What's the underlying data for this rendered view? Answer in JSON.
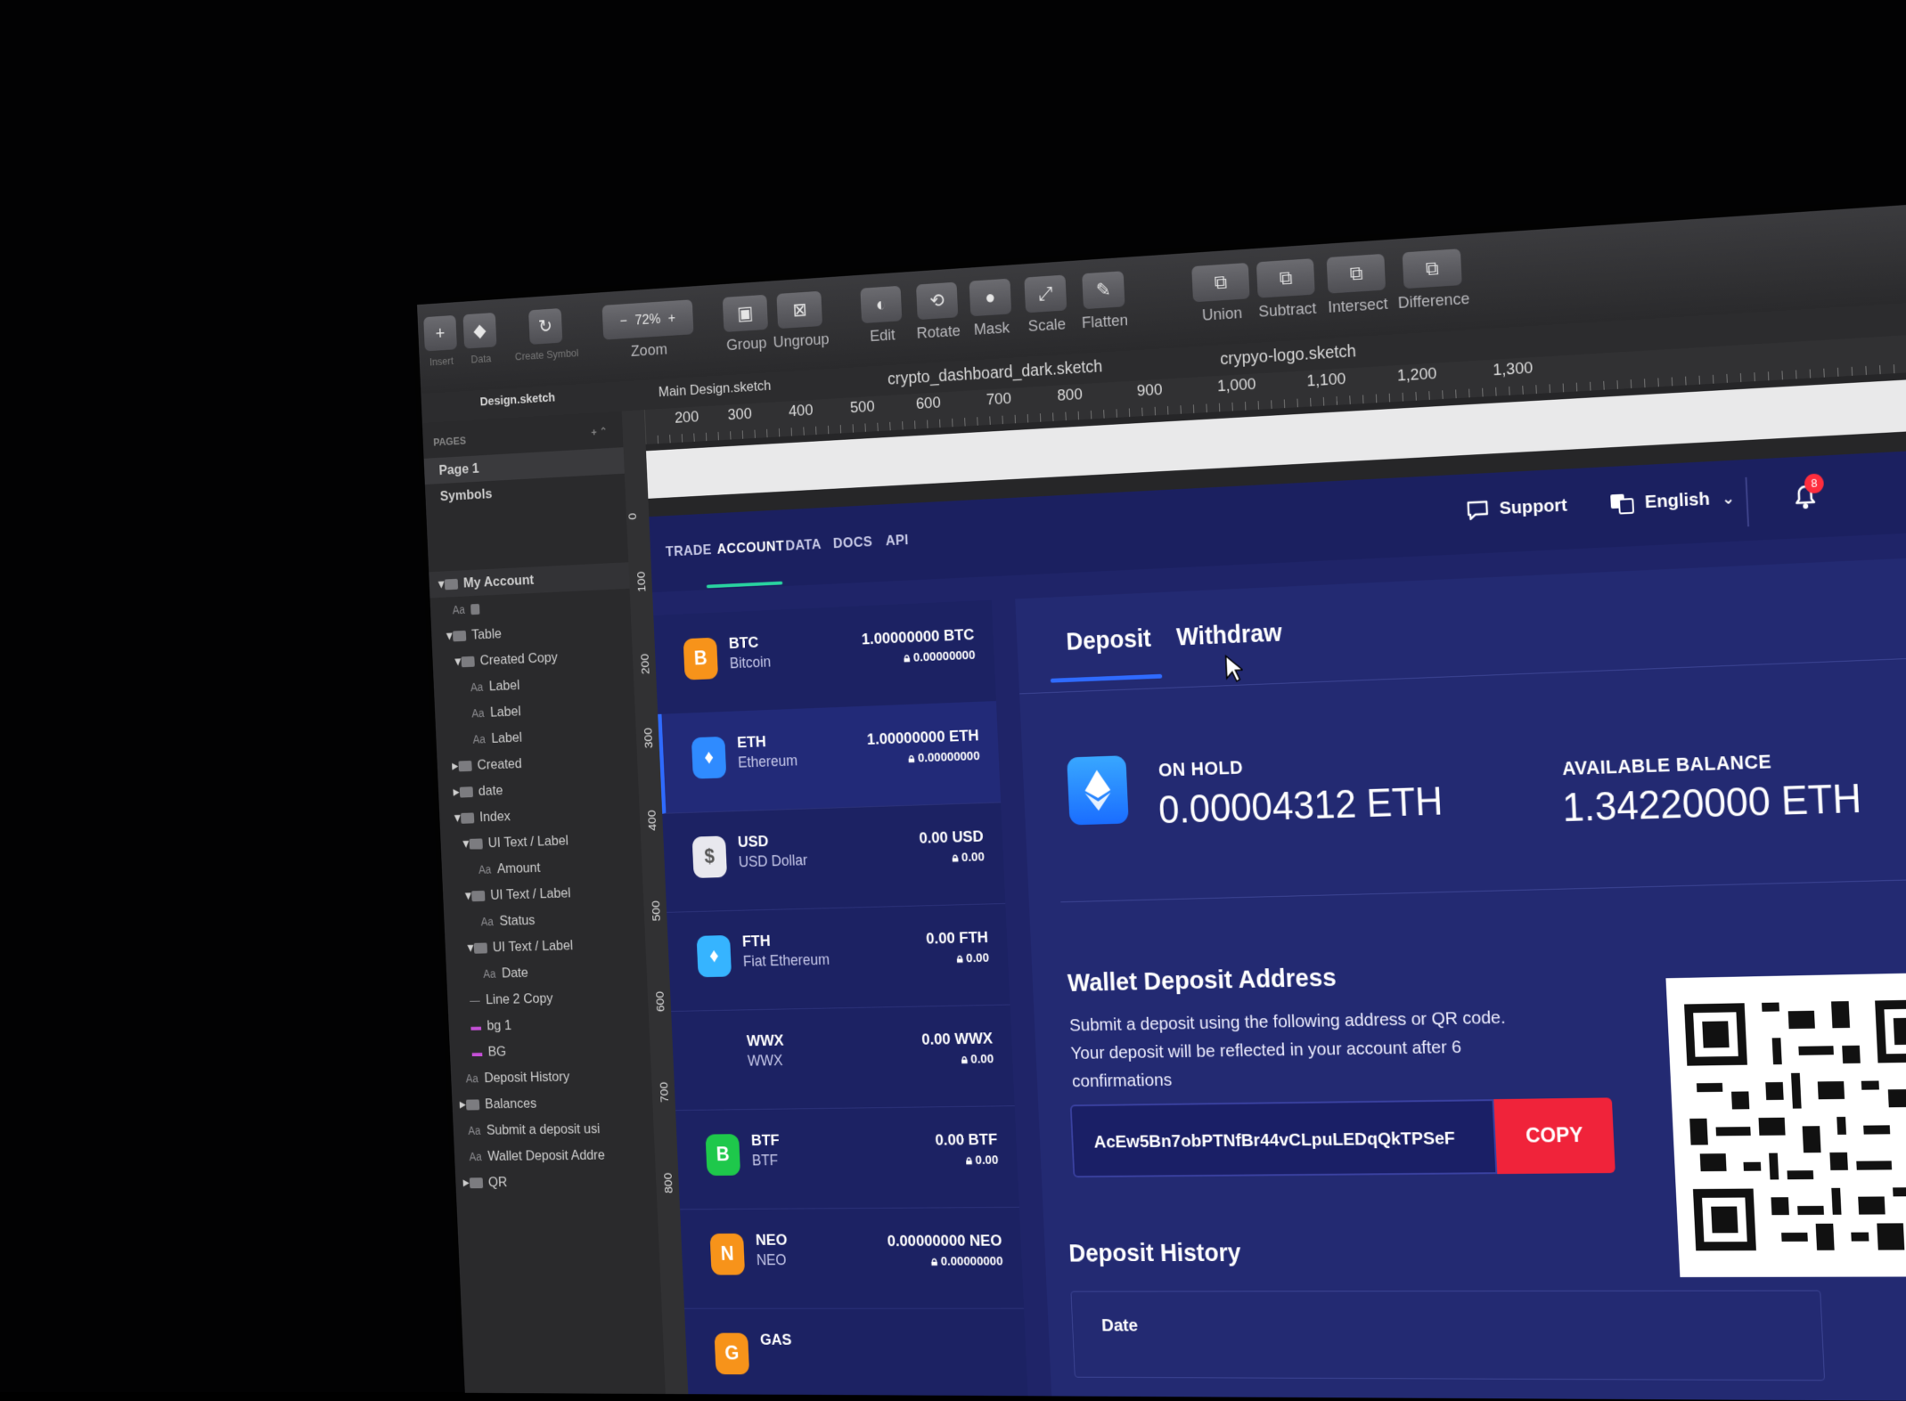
{
  "toolbar": {
    "insert": "Insert",
    "data": "Data",
    "create_symbol": "Create Symbol",
    "zoom_value": "72%",
    "zoom_label": "Zoom",
    "group": "Group",
    "ungroup": "Ungroup",
    "edit": "Edit",
    "rotate": "Rotate",
    "mask": "Mask",
    "scale": "Scale",
    "flatten": "Flatten",
    "union": "Union",
    "subtract": "Subtract",
    "intersect": "Intersect",
    "difference": "Difference"
  },
  "doc_tabs": [
    "Design.sketch",
    "Main Design.sketch",
    "crypto_dashboard_dark.sketch",
    "crypyo-logo.sketch"
  ],
  "ruler": {
    "h": [
      "200",
      "300",
      "400",
      "500",
      "600",
      "700",
      "800",
      "900",
      "1,000",
      "1,100",
      "1,200",
      "1,300"
    ],
    "v": [
      "0",
      "100",
      "200",
      "300",
      "400",
      "500",
      "600",
      "700",
      "800"
    ]
  },
  "layers": {
    "pages_label": "PAGES",
    "pages": [
      "Page 1",
      "Symbols"
    ],
    "items": [
      "My Account",
      "Aa",
      "Table",
      "Created Copy",
      "Label",
      "Label",
      "Label",
      "Created",
      "date",
      "Index",
      "UI Text / Label",
      "Amount",
      "UI Text / Label",
      "Status",
      "UI Text / Label",
      "Date",
      "Line 2 Copy",
      "bg 1",
      "BG",
      "Deposit History",
      "Balances",
      "Submit a deposit usi",
      "Wallet Deposit Addre",
      "QR"
    ]
  },
  "nav": {
    "items": [
      "TRADE",
      "ACCOUNT",
      "DATA",
      "DOCS",
      "API"
    ],
    "support": "Support",
    "language": "English",
    "notifications": "8"
  },
  "assets": [
    {
      "symbol": "BTC",
      "name": "Bitcoin",
      "amount": "1.00000000 BTC",
      "hold": "0.00000000",
      "color": "#f7931a",
      "glyph": "B"
    },
    {
      "symbol": "ETH",
      "name": "Ethereum",
      "amount": "1.00000000 ETH",
      "hold": "0.00000000",
      "color": "#2f8bff",
      "glyph": "♦"
    },
    {
      "symbol": "USD",
      "name": "USD Dollar",
      "amount": "0.00 USD",
      "hold": "0.00",
      "color": "#e8e8ee",
      "glyph": "$"
    },
    {
      "symbol": "FTH",
      "name": "Fiat Ethereum",
      "amount": "0.00 FTH",
      "hold": "0.00",
      "color": "#36b4ff",
      "glyph": "♦"
    },
    {
      "symbol": "WWX",
      "name": "WWX",
      "amount": "0.00 WWX",
      "hold": "0.00",
      "color": "transparent",
      "glyph": ""
    },
    {
      "symbol": "BTF",
      "name": "BTF",
      "amount": "0.00 BTF",
      "hold": "0.00",
      "color": "#1ec84b",
      "glyph": "B"
    },
    {
      "symbol": "NEO",
      "name": "NEO",
      "amount": "0.00000000 NEO",
      "hold": "0.00000000",
      "color": "#f7931a",
      "glyph": "N"
    },
    {
      "symbol": "GAS",
      "name": "",
      "amount": "",
      "hold": "",
      "color": "#f7931a",
      "glyph": "G"
    }
  ],
  "detail": {
    "tab_deposit": "Deposit",
    "tab_withdraw": "Withdraw",
    "on_hold_label": "ON HOLD",
    "on_hold_value": "0.00004312 ETH",
    "available_label": "AVAILABLE BALANCE",
    "available_value": "1.34220000 ETH",
    "wallet_title": "Wallet Deposit Address",
    "wallet_desc": "Submit a deposit using the following address or QR code. Your deposit will be reflected in your account after 6 confirmations",
    "address": "AcEw5Bn7obPTNfBr44vCLpuLEDqQkTPSeF",
    "copy": "COPY",
    "history_title": "Deposit History",
    "history_col_date": "Date"
  },
  "colors": {
    "nav_bg": "#1b2060",
    "panel_bg": "#232a72",
    "accent_green": "#29d3a0",
    "accent_blue": "#2f6bff",
    "copy_red": "#f0233a",
    "badge_red": "#ff2d3d"
  }
}
